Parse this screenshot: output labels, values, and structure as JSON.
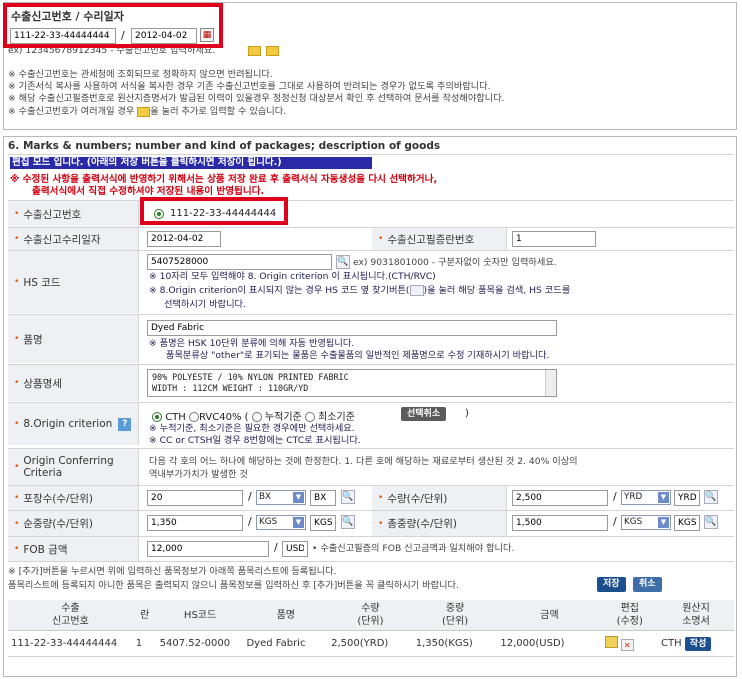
{
  "top": {
    "title": "수출신고번호 / 수리일자",
    "export_no": "111-22-33-44444444",
    "sep": "/",
    "date": "2012-04-02",
    "hint": "ex) 12345678912345 - 수출신고번호 입력하세요.",
    "notes": [
      "※ 수출신고번호는 관세청에 조회되므로 정확하지 않으면 반려됩니다.",
      "※ 기존서식 복사를 사용하여 서식을 복사한 경우 기존 수출신고번호를 그대로 사용하여 반려되는 경우가 없도록 주의바랍니다.",
      "※ 해당 수출신고필증번호로 원산지증명서가 발급된 이력이 있을경우 정정신청 대상분서 확인 후 선택하여 문서를 작성해야합니다.",
      "※ 수출신고번호가 여러개일 경우 ",
      "을 눌러 추가로 입력할 수 있습니다."
    ]
  },
  "main": {
    "title": "6. Marks & numbers; number and kind of packages; description of goods",
    "bluebar": "편집 모드 입니다. (아래의 저장 버튼을 클릭하시면 저장이 됩니다.)",
    "warn1": "※ 수정된 사항을 출력서식에 반영하기 위해서는 상품 저장 완료 후 출력서식 자동생성을 다시 선택하거나,",
    "warn2": "출력서식에서 직접 수정하셔야 저장된 내용이 반영됩니다.",
    "rows": {
      "export_no_label": "수출신고번호",
      "export_no_value": "111-22-33-44444444",
      "accept_date_label": "수출신고수리일자",
      "accept_date_value": "2012-04-02",
      "dist_no_label": "수출신고필증란번호",
      "dist_no_value": "1",
      "hs_label": "HS 코드",
      "hs_value": "5407528000",
      "hs_hint": "ex) 9031801000 - 구분자없이 숫자만 입력하세요.",
      "hs_note1": "※ 10자리 모두 입력해야 8. Origin criterion 이 표시됩니다.(CTH/RVC)",
      "hs_note2a": "※ 8.Origin criterion이 표시되지 않는 경우 HS 코드 옆 찾기버튼(",
      "hs_note2b": ")을 눌러 해당 품목을 검색, HS 코드를",
      "hs_note3": "선택하시기 바랍니다.",
      "item_label": "품명",
      "item_value": "Dyed Fabric",
      "item_note1": "※ 품명은 HSK 10단위 분류에 의해 자동 반영됩니다.",
      "item_note2": "품목분류상 \"other\"로 표기되는 물품은 수출물품의 일반적인 제품명으로 수정 기재하시기 바랍니다.",
      "spec_label": "상품명세",
      "spec_line1": "90% POLYESTE / 10% NYLON PRINTED FABRIC",
      "spec_line2": "WIDTH : 112CM WEIGHT : 110GR/YD",
      "origin_label": "8.Origin criterion",
      "opt_cth": "CTH",
      "opt_rvc": "RVC40%",
      "opt_open": "(",
      "opt_cum": "누적기준",
      "opt_min": "최소기준",
      "opt_cancel": "선택취소",
      "opt_close": ")",
      "origin_note1": "※ 누적기준, 최소기준은 필요한 경우에만 선택하세요.",
      "origin_note2": "※ CC or CTSH일 경우 8번항에는 CTC로 표시됩니다.",
      "conf_label": "Origin Conferring Criteria",
      "conf_text1": "다음 각 호의 어느 하나에 해당하는 것에 한정한다. 1. 다른 호에 해당하는 재료로부터 생산된 것 2. 40% 이상의",
      "conf_text2": "역내부가가치가 발생한 것",
      "pack_label": "포장수(수/단위)",
      "pack_value": "20",
      "pack_unit": "BX",
      "qty_label": "수량(수/단위)",
      "qty_value": "2,500",
      "qty_unit": "YRD",
      "net_label": "순중량(수/단위)",
      "net_value": "1,350",
      "net_unit": "KGS",
      "gross_label": "총중량(수/단위)",
      "gross_value": "1,500",
      "gross_unit": "KGS",
      "fob_label": "FOB 금액",
      "fob_value": "12,000",
      "fob_unit": "USD",
      "fob_note": "• 수출신고필증의 FOB 신고금액과 일치해야 합니다.",
      "slash": "/"
    },
    "bottom_note1": "※ [추가]버튼을 누르시면 위에 입력하신 품목정보가 아래쪽 품목리스트에 등록됩니다.",
    "bottom_note2": "품목리스트에 등록되지 아니한 품목은 출력되지 않으니 품목정보를 입력하신 후 [추가]버튼을 꼭 클릭하시기 바랍니다.",
    "save_btn": "저장",
    "cancel_btn": "취소",
    "table": {
      "headers": [
        "수출\n신고번호",
        "란",
        "HS코드",
        "품명",
        "수량\n(단위)",
        "중량\n(단위)",
        "금액",
        "편집\n(수정)",
        "원산지\n소명서"
      ],
      "row": [
        "111-22-33-44444444",
        "1",
        "5407.52-0000",
        "Dyed Fabric",
        "2,500(YRD)",
        "1,350(KGS)",
        "12,000(USD)",
        "",
        "CTH"
      ],
      "write_btn": "작성"
    }
  }
}
